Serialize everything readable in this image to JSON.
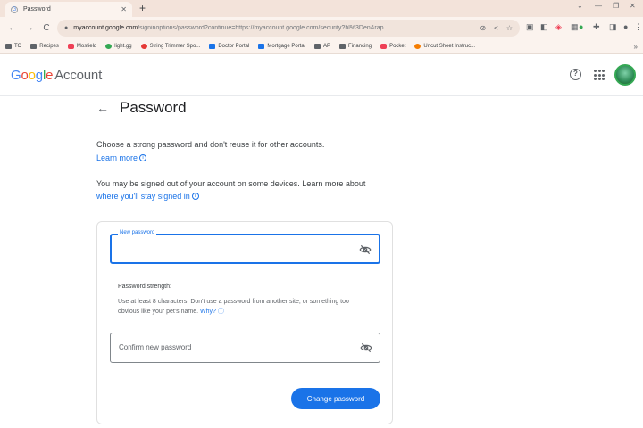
{
  "browser": {
    "tab_title": "Password",
    "new_tab": "+",
    "url_host": "myaccount.google.com",
    "url_rest": "/signinoptions/password?continue=https://myaccount.google.com/security?hl%3Den&rap...",
    "bookmarks": [
      {
        "label": "TO",
        "icon": "apps-icon",
        "color": "dark"
      },
      {
        "label": "Recipes",
        "icon": "folder-icon",
        "color": "dark"
      },
      {
        "label": "Mosfield",
        "icon": "site-icon",
        "color": "pink"
      },
      {
        "label": "light.gg",
        "icon": "site-icon",
        "color": "green"
      },
      {
        "label": "String Trimmer Spo...",
        "icon": "youtube-icon",
        "color": "red"
      },
      {
        "label": "Doctor Portal",
        "icon": "site-icon",
        "color": "blue"
      },
      {
        "label": "Mortgage Portal",
        "icon": "site-icon",
        "color": "blue"
      },
      {
        "label": "AP",
        "icon": "folder-icon",
        "color": "dark"
      },
      {
        "label": "Financing",
        "icon": "folder-icon",
        "color": "dark"
      },
      {
        "label": "Pocket",
        "icon": "pocket-icon",
        "color": "pink"
      },
      {
        "label": "Uncut Sheet Instruc...",
        "icon": "site-icon",
        "color": "orange"
      }
    ]
  },
  "header": {
    "logo_letters": [
      "G",
      "o",
      "o",
      "g",
      "l",
      "e"
    ],
    "logo_suffix": "Account",
    "help_glyph": "?"
  },
  "page": {
    "title": "Password",
    "intro": "Choose a strong password and don't reuse it for other accounts.",
    "learn_more": "Learn more",
    "signout_note": "You may be signed out of your account on some devices. Learn more about",
    "stay_signed_in": "where you'll stay signed in"
  },
  "form": {
    "new_password_label": "New password",
    "new_password_value": "",
    "strength_label": "Password strength:",
    "strength_desc": "Use at least 8 characters. Don't use a password from another site, or something too obvious like your pet's name.",
    "why_link": "Why?",
    "confirm_placeholder": "Confirm new password",
    "submit_label": "Change password"
  },
  "colors": {
    "accent": "#1a73e8",
    "chrome_tabstrip": "#f3e3da",
    "chrome_toolbar": "#fbf3ee"
  }
}
